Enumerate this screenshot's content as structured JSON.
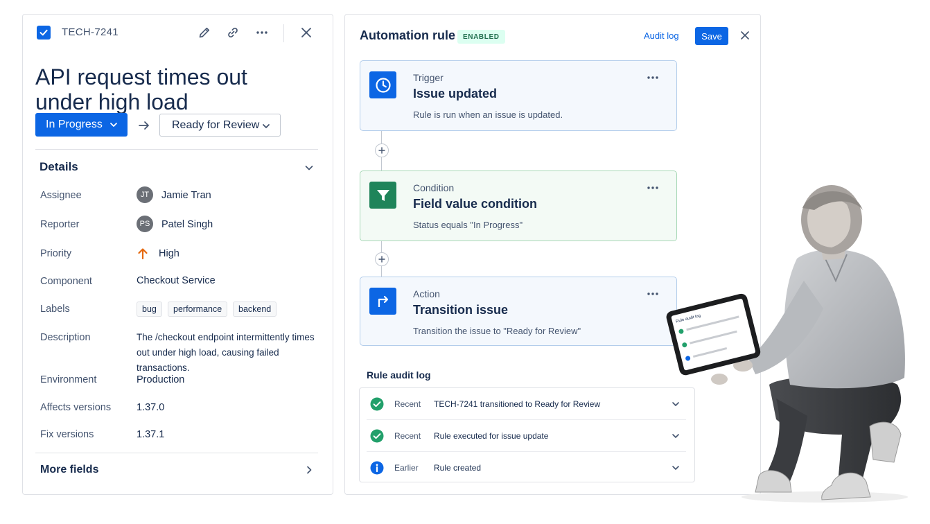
{
  "issue": {
    "key": "TECH-7241",
    "title": "API request times out under high load",
    "status": "In Progress",
    "next_status": "Ready for Review",
    "details_heading": "Details",
    "fields": {
      "assignee_label": "Assignee",
      "assignee_initials": "JT",
      "assignee_name": "Jamie Tran",
      "reporter_label": "Reporter",
      "reporter_initials": "PS",
      "reporter_name": "Patel Singh",
      "priority_label": "Priority",
      "priority_value": "High",
      "component_label": "Component",
      "component_value": "Checkout Service",
      "labels_label": "Labels",
      "labels": [
        "bug",
        "performance",
        "backend"
      ],
      "description_label": "Description",
      "description_value": "The /checkout endpoint intermittently times out under high load, causing failed transactions.",
      "environment_label": "Environment",
      "environment_value": "Production",
      "affects_label": "Affects versions",
      "affects_value": "1.37.0",
      "fix_label": "Fix versions",
      "fix_value": "1.37.1"
    },
    "more_fields": "More fields"
  },
  "automation": {
    "title": "Automation rule",
    "badge": "ENABLED",
    "audit_link": "Audit log",
    "save_label": "Save",
    "trigger": {
      "kind": "Trigger",
      "name": "Issue updated",
      "desc": "Rule is run when an issue is updated."
    },
    "condition": {
      "kind": "Condition",
      "name": "Field value condition",
      "desc": "Status equals \"In Progress\""
    },
    "action": {
      "kind": "Action",
      "name": "Transition issue",
      "desc": "Transition the issue to \"Ready for Review\""
    },
    "audit_title": "Rule audit log",
    "audit": [
      {
        "when": "Recent",
        "msg": "TECH-7241 transitioned to Ready for Review"
      },
      {
        "when": "Recent",
        "msg": "Rule executed for issue update"
      },
      {
        "when": "Earlier",
        "msg": "Rule created"
      }
    ]
  },
  "colors": {
    "primary": "#0c66e4",
    "success": "#22a06b",
    "priority_high": "#e56910",
    "condition_green": "#1f845a"
  },
  "illustration": {
    "tablet_heading": "Rule audit log"
  }
}
